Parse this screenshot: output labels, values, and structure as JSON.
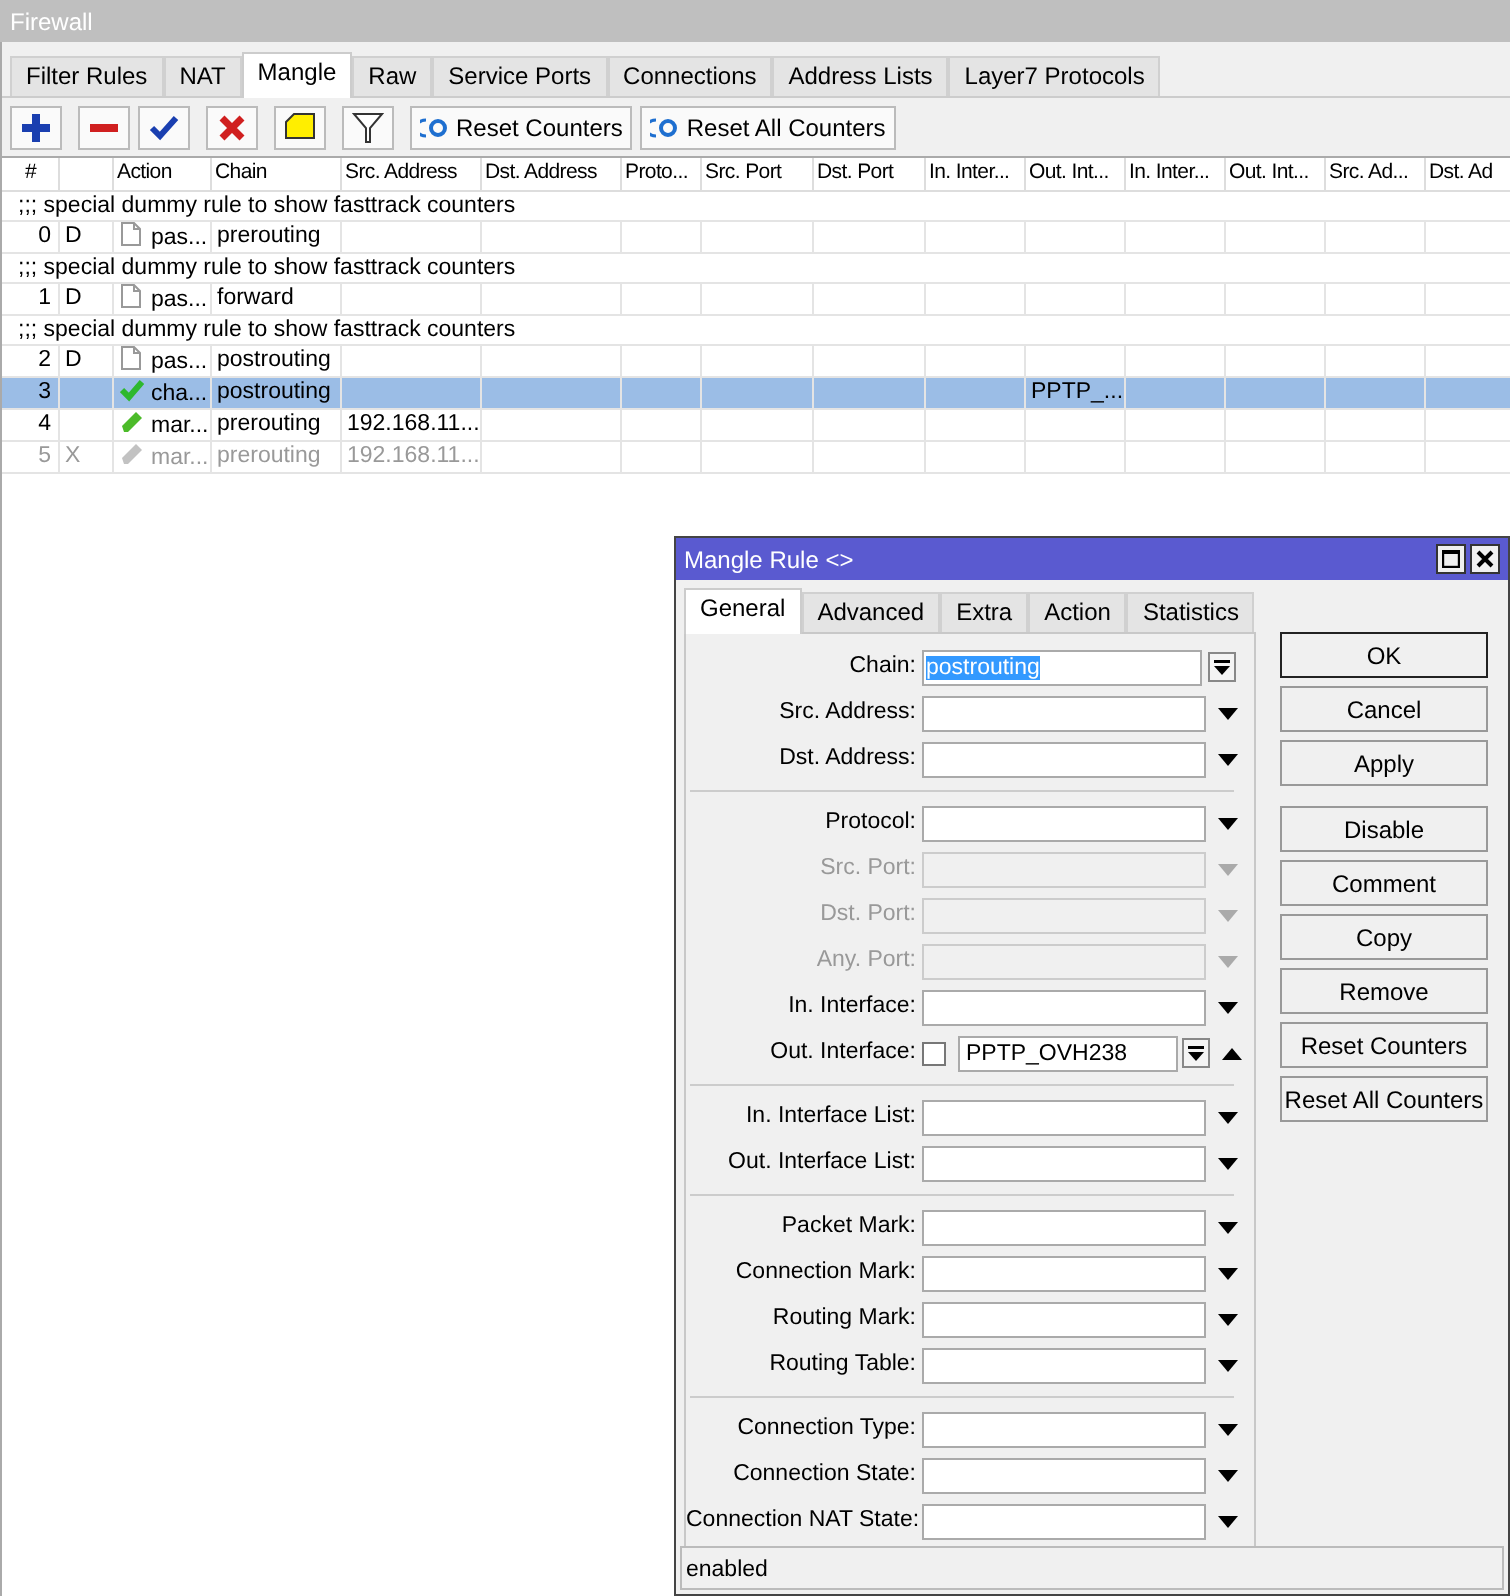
{
  "window": {
    "title": "Firewall"
  },
  "tabs": [
    {
      "label": "Filter Rules",
      "selected": false
    },
    {
      "label": "NAT",
      "selected": false
    },
    {
      "label": "Mangle",
      "selected": true
    },
    {
      "label": "Raw",
      "selected": false
    },
    {
      "label": "Service Ports",
      "selected": false
    },
    {
      "label": "Connections",
      "selected": false
    },
    {
      "label": "Address Lists",
      "selected": false
    },
    {
      "label": "Layer7 Protocols",
      "selected": false
    }
  ],
  "toolbar": [
    {
      "kind": "add"
    },
    {
      "kind": "remove"
    },
    {
      "kind": "enable"
    },
    {
      "kind": "disable"
    },
    {
      "kind": "comment"
    },
    {
      "kind": "filter"
    },
    {
      "kind": "reset",
      "label": "Reset Counters"
    },
    {
      "kind": "reset",
      "label": "Reset All Counters"
    }
  ],
  "table": {
    "columns": [
      "#",
      "Action",
      "Chain",
      "Src. Address",
      "Dst. Address",
      "Proto...",
      "Src. Port",
      "Dst. Port",
      "In. Inter...",
      "Out. Int...",
      "In. Inter...",
      "Out. Int...",
      "Src. Ad...",
      "Dst. Ad"
    ],
    "rows": [
      {
        "kind": "comment",
        "text": ";;; special dummy rule to show fasttrack counters"
      },
      {
        "kind": "passthrough",
        "number": "0",
        "flag": "D",
        "action": "pas...",
        "chain": "prerouting",
        "selected": false,
        "disabled": false
      },
      {
        "kind": "comment",
        "text": ";;; special dummy rule to show fasttrack counters"
      },
      {
        "kind": "passthrough",
        "number": "1",
        "flag": "D",
        "action": "pas...",
        "chain": "forward",
        "selected": false,
        "disabled": false
      },
      {
        "kind": "comment",
        "text": ";;; special dummy rule to show fasttrack counters"
      },
      {
        "kind": "passthrough",
        "number": "2",
        "flag": "D",
        "action": "pas...",
        "chain": "postrouting",
        "selected": false,
        "disabled": false
      },
      {
        "kind": "change",
        "number": "3",
        "action": "cha...",
        "chain": "postrouting",
        "out_interface": "PPTP_...",
        "selected": true,
        "disabled": false
      },
      {
        "kind": "mark",
        "number": "4",
        "action": "mar...",
        "chain": "prerouting",
        "src_address": "192.168.11...",
        "selected": false,
        "disabled": false
      },
      {
        "kind": "mark",
        "number": "5",
        "flag": "X",
        "action": "mar...",
        "chain": "prerouting",
        "src_address": "192.168.11...",
        "selected": false,
        "disabled": true
      }
    ]
  },
  "dialog": {
    "title": "Mangle Rule <>",
    "tabs": [
      {
        "label": "General",
        "selected": true
      },
      {
        "label": "Advanced",
        "selected": false
      },
      {
        "label": "Extra",
        "selected": false
      },
      {
        "label": "Action",
        "selected": false
      },
      {
        "label": "Statistics",
        "selected": false
      }
    ],
    "groups": [
      [
        {
          "kind": "combo",
          "label": "Chain:",
          "value": "postrouting",
          "disabled": false
        },
        {
          "kind": "select",
          "label": "Src. Address:",
          "disabled": false
        },
        {
          "kind": "select",
          "label": "Dst. Address:",
          "disabled": false
        }
      ],
      [
        {
          "kind": "select",
          "label": "Protocol:",
          "disabled": false
        },
        {
          "kind": "select",
          "label": "Src. Port:",
          "disabled": true
        },
        {
          "kind": "select",
          "label": "Dst. Port:",
          "disabled": true
        },
        {
          "kind": "select",
          "label": "Any. Port:",
          "disabled": true
        },
        {
          "kind": "select",
          "label": "In. Interface:",
          "disabled": false
        },
        {
          "kind": "negated",
          "label": "Out. Interface:",
          "value": "PPTP_OVH238",
          "checked": false,
          "disabled": false
        }
      ],
      [
        {
          "kind": "select",
          "label": "In. Interface List:",
          "disabled": false
        },
        {
          "kind": "select",
          "label": "Out. Interface List:",
          "disabled": false
        }
      ],
      [
        {
          "kind": "select",
          "label": "Packet Mark:",
          "disabled": false
        },
        {
          "kind": "select",
          "label": "Connection Mark:",
          "disabled": false
        },
        {
          "kind": "select",
          "label": "Routing Mark:",
          "disabled": false
        },
        {
          "kind": "select",
          "label": "Routing Table:",
          "disabled": false
        }
      ],
      [
        {
          "kind": "select",
          "label": "Connection Type:",
          "disabled": false
        },
        {
          "kind": "select",
          "label": "Connection State:",
          "disabled": false
        },
        {
          "kind": "select",
          "label": "Connection NAT State:",
          "disabled": false
        }
      ]
    ],
    "buttons": [
      {
        "label": "OK",
        "focused": true
      },
      {
        "label": "Cancel",
        "focused": false
      },
      {
        "label": "Apply",
        "focused": false
      },
      {
        "label": "Disable",
        "focused": false
      },
      {
        "label": "Comment",
        "focused": false
      },
      {
        "label": "Copy",
        "focused": false
      },
      {
        "label": "Remove",
        "focused": false
      },
      {
        "label": "Reset Counters",
        "focused": false
      },
      {
        "label": "Reset All Counters",
        "focused": false
      }
    ],
    "status": "enabled"
  }
}
